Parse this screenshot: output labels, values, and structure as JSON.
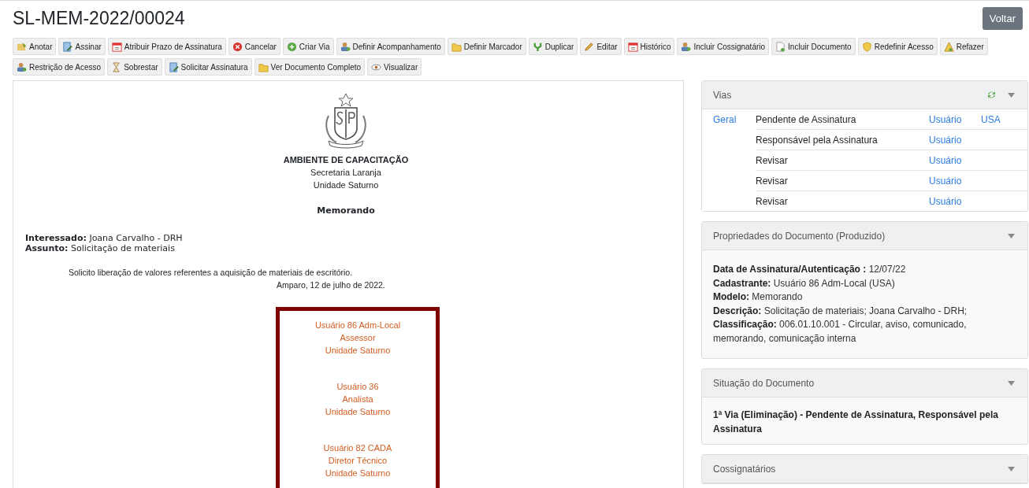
{
  "title": "SL-MEM-2022/00024",
  "back_button": "Voltar",
  "toolbar": [
    {
      "label": "Anotar",
      "kind": "note"
    },
    {
      "label": "Assinar",
      "kind": "sign"
    },
    {
      "label": "Atribuir Prazo de Assinatura",
      "kind": "calendar"
    },
    {
      "label": "Cancelar",
      "kind": "cancel"
    },
    {
      "label": "Criar Via",
      "kind": "add"
    },
    {
      "label": "Definir Acompanhamento",
      "kind": "user"
    },
    {
      "label": "Definir Marcador",
      "kind": "folder"
    },
    {
      "label": "Duplicar",
      "kind": "fork"
    },
    {
      "label": "Editar",
      "kind": "pencil"
    },
    {
      "label": "Histórico",
      "kind": "calendar"
    },
    {
      "label": "Incluir Cossignatário",
      "kind": "user"
    },
    {
      "label": "Incluir Documento",
      "kind": "page"
    },
    {
      "label": "Redefinir Acesso",
      "kind": "shield"
    },
    {
      "label": "Refazer",
      "kind": "warning"
    },
    {
      "label": "Restrição de Acesso",
      "kind": "user"
    },
    {
      "label": "Sobrestar",
      "kind": "hourglass"
    },
    {
      "label": "Solicitar Assinatura",
      "kind": "sign"
    },
    {
      "label": "Ver Documento Completo",
      "kind": "folder"
    },
    {
      "label": "Visualizar",
      "kind": "eye"
    }
  ],
  "document": {
    "org": "AMBIENTE DE CAPACITAÇÃO",
    "dept": "Secretaria Laranja",
    "unit": "Unidade Saturno",
    "type": "Memorando",
    "fields": [
      {
        "label": "Interessado:",
        "value": "Joana Carvalho - DRH"
      },
      {
        "label": "Assunto:",
        "value": "Solicitação de materiais"
      }
    ],
    "body": "Solicito liberação de valores referentes a aquisição de materiais de escritório.",
    "place_date": "Amparo, 12 de julho de 2022.",
    "signatures": [
      [
        "Usuário 86 Adm-Local",
        "Assessor",
        "Unidade Saturno"
      ],
      [
        "Usuário 36",
        "Analista",
        "Unidade Saturno"
      ],
      [
        "Usuário 82 CADA",
        "Diretor Técnico",
        "Unidade Saturno"
      ]
    ]
  },
  "vias": {
    "title": "Vias",
    "rows": [
      {
        "via": "Geral",
        "status": "Pendente de Assinatura",
        "user": "Usuário",
        "unit": "USA"
      },
      {
        "status": "Responsável pela Assinatura",
        "user": "Usuário"
      },
      {
        "status": "Revisar",
        "user": "Usuário"
      },
      {
        "status": "Revisar",
        "user": "Usuário"
      },
      {
        "status": "Revisar",
        "user": "Usuário"
      }
    ]
  },
  "properties": {
    "title": "Propriedades do Documento (Produzido)",
    "items": [
      {
        "label": "Data de Assinatura/Autenticação :",
        "value": "12/07/22"
      },
      {
        "label": "Cadastrante:",
        "value": "Usuário 86 Adm-Local (USA)"
      },
      {
        "label": "Modelo:",
        "value": "Memorando"
      },
      {
        "label": "Descrição:",
        "value": "Solicitação de materiais; Joana Carvalho - DRH;"
      },
      {
        "label": "Classificação:",
        "value": "006.01.10.001 - Circular, aviso, comunicado, memorando, comunicação interna"
      }
    ]
  },
  "situation": {
    "title": "Situação do Documento",
    "text": "1ª Via (Eliminação) - Pendente de Assinatura, Responsável pela Assinatura"
  },
  "cosigners": {
    "title": "Cossignatários"
  }
}
